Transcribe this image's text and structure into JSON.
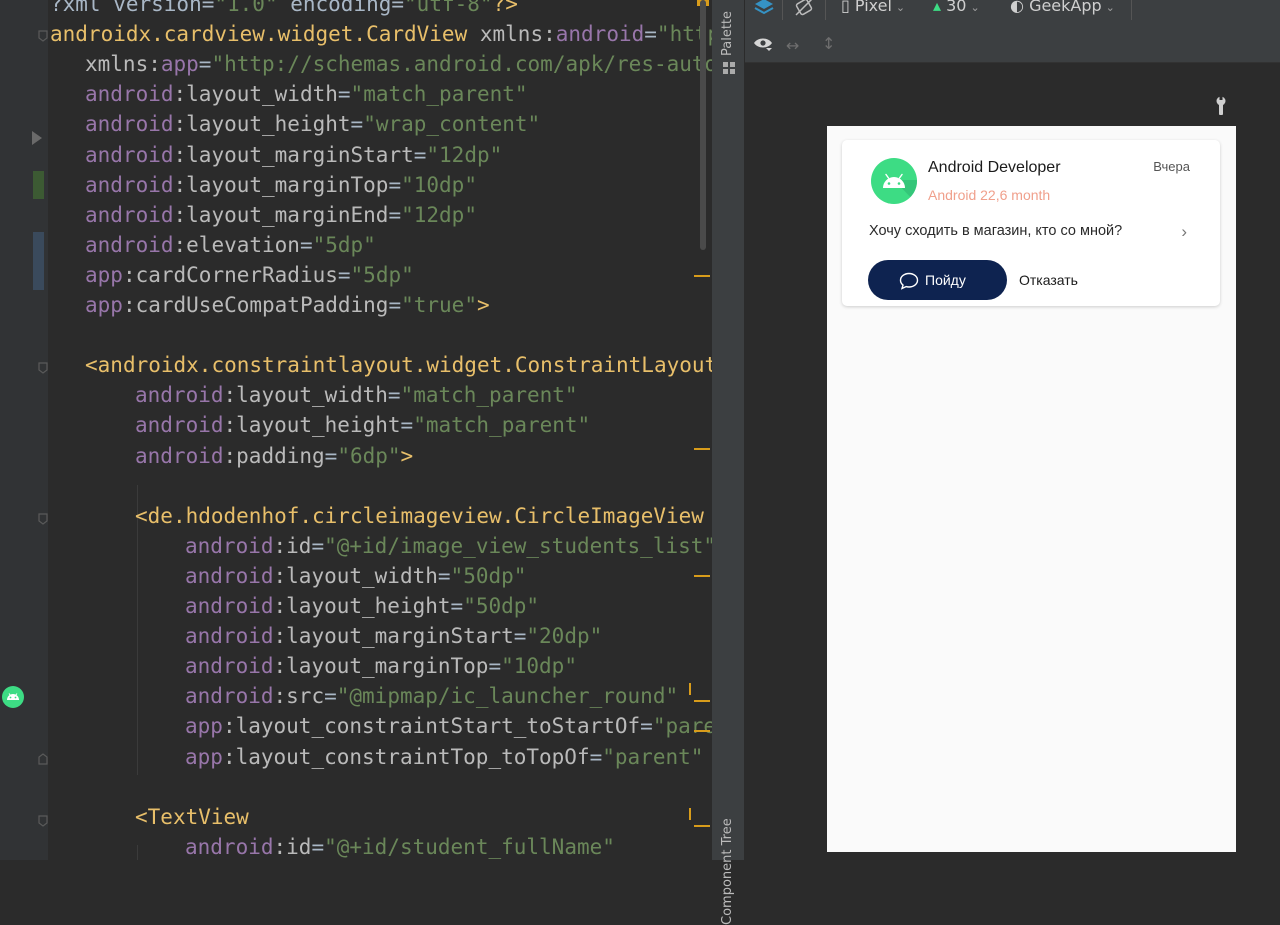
{
  "editor": {
    "lines": [
      [
        {
          "t": "?xml version=",
          "c": "tk-punc"
        },
        {
          "t": "\"1.0\"",
          "c": "tk-val"
        },
        {
          "t": " encoding=",
          "c": "tk-punc"
        },
        {
          "t": "\"utf-8\"",
          "c": "tk-val"
        },
        {
          "t": "?>",
          "c": "tk-br"
        }
      ],
      [
        {
          "t": "androidx.cardview.widget.CardView",
          "c": "tk-tag"
        },
        {
          "t": " xmlns:",
          "c": "tk-at"
        },
        {
          "t": "android",
          "c": "tk-ns"
        },
        {
          "t": "=",
          "c": "tk-punc"
        },
        {
          "t": "\"http",
          "c": "tk-val"
        }
      ],
      [
        {
          "t": "xmlns:",
          "c": "tk-at"
        },
        {
          "t": "app",
          "c": "tk-ns"
        },
        {
          "t": "=",
          "c": "tk-punc"
        },
        {
          "t": "\"http://schemas.android.com/apk/res-auto",
          "c": "tk-val"
        }
      ],
      [
        {
          "t": "android",
          "c": "tk-ns"
        },
        {
          "t": ":layout_width",
          "c": "tk-at"
        },
        {
          "t": "=",
          "c": "tk-punc"
        },
        {
          "t": "\"match_parent\"",
          "c": "tk-val"
        }
      ],
      [
        {
          "t": "android",
          "c": "tk-ns"
        },
        {
          "t": ":layout_height",
          "c": "tk-at"
        },
        {
          "t": "=",
          "c": "tk-punc"
        },
        {
          "t": "\"wrap_content\"",
          "c": "tk-val"
        }
      ],
      [
        {
          "t": "android",
          "c": "tk-ns"
        },
        {
          "t": ":layout_marginStart",
          "c": "tk-at"
        },
        {
          "t": "=",
          "c": "tk-punc"
        },
        {
          "t": "\"12dp\"",
          "c": "tk-val"
        }
      ],
      [
        {
          "t": "android",
          "c": "tk-ns"
        },
        {
          "t": ":layout_marginTop",
          "c": "tk-at"
        },
        {
          "t": "=",
          "c": "tk-punc"
        },
        {
          "t": "\"10dp\"",
          "c": "tk-val"
        }
      ],
      [
        {
          "t": "android",
          "c": "tk-ns"
        },
        {
          "t": ":layout_marginEnd",
          "c": "tk-at"
        },
        {
          "t": "=",
          "c": "tk-punc"
        },
        {
          "t": "\"12dp\"",
          "c": "tk-val"
        }
      ],
      [
        {
          "t": "android",
          "c": "tk-ns"
        },
        {
          "t": ":elevation",
          "c": "tk-at"
        },
        {
          "t": "=",
          "c": "tk-punc"
        },
        {
          "t": "\"5dp\"",
          "c": "tk-val"
        }
      ],
      [
        {
          "t": "app",
          "c": "tk-ns"
        },
        {
          "t": ":cardCornerRadius",
          "c": "tk-at"
        },
        {
          "t": "=",
          "c": "tk-punc"
        },
        {
          "t": "\"5dp\"",
          "c": "tk-val"
        }
      ],
      [
        {
          "t": "app",
          "c": "tk-ns"
        },
        {
          "t": ":cardUseCompatPadding",
          "c": "tk-at"
        },
        {
          "t": "=",
          "c": "tk-punc"
        },
        {
          "t": "\"true\"",
          "c": "tk-val"
        },
        {
          "t": ">",
          "c": "tk-br"
        }
      ],
      [],
      [
        {
          "t": "<",
          "c": "tk-br"
        },
        {
          "t": "androidx.constraintlayout.widget.ConstraintLayout",
          "c": "tk-tag"
        }
      ],
      [
        {
          "t": "android",
          "c": "tk-ns"
        },
        {
          "t": ":layout_width",
          "c": "tk-at"
        },
        {
          "t": "=",
          "c": "tk-punc"
        },
        {
          "t": "\"match_parent\"",
          "c": "tk-val"
        }
      ],
      [
        {
          "t": "android",
          "c": "tk-ns"
        },
        {
          "t": ":layout_height",
          "c": "tk-at"
        },
        {
          "t": "=",
          "c": "tk-punc"
        },
        {
          "t": "\"match_parent\"",
          "c": "tk-val"
        }
      ],
      [
        {
          "t": "android",
          "c": "tk-ns"
        },
        {
          "t": ":padding",
          "c": "tk-at"
        },
        {
          "t": "=",
          "c": "tk-punc"
        },
        {
          "t": "\"6dp\"",
          "c": "tk-val"
        },
        {
          "t": ">",
          "c": "tk-br"
        }
      ],
      [],
      [
        {
          "t": "<",
          "c": "tk-br"
        },
        {
          "t": "de.hdodenhof.circleimageview.CircleImageView",
          "c": "tk-tag"
        }
      ],
      [
        {
          "t": "android",
          "c": "tk-ns"
        },
        {
          "t": ":id",
          "c": "tk-at"
        },
        {
          "t": "=",
          "c": "tk-punc"
        },
        {
          "t": "\"@+id/image_view_students_list\"",
          "c": "tk-val"
        }
      ],
      [
        {
          "t": "android",
          "c": "tk-ns"
        },
        {
          "t": ":layout_width",
          "c": "tk-at"
        },
        {
          "t": "=",
          "c": "tk-punc"
        },
        {
          "t": "\"50dp\"",
          "c": "tk-val"
        }
      ],
      [
        {
          "t": "android",
          "c": "tk-ns"
        },
        {
          "t": ":layout_height",
          "c": "tk-at"
        },
        {
          "t": "=",
          "c": "tk-punc"
        },
        {
          "t": "\"50dp\"",
          "c": "tk-val"
        }
      ],
      [
        {
          "t": "android",
          "c": "tk-ns"
        },
        {
          "t": ":layout_marginStart",
          "c": "tk-at"
        },
        {
          "t": "=",
          "c": "tk-punc"
        },
        {
          "t": "\"20dp\"",
          "c": "tk-val"
        }
      ],
      [
        {
          "t": "android",
          "c": "tk-ns"
        },
        {
          "t": ":layout_marginTop",
          "c": "tk-at"
        },
        {
          "t": "=",
          "c": "tk-punc"
        },
        {
          "t": "\"10dp\"",
          "c": "tk-val"
        }
      ],
      [
        {
          "t": "android",
          "c": "tk-ns"
        },
        {
          "t": ":src",
          "c": "tk-at"
        },
        {
          "t": "=",
          "c": "tk-punc"
        },
        {
          "t": "\"@mipmap/ic_launcher_round\"",
          "c": "tk-val"
        }
      ],
      [
        {
          "t": "app",
          "c": "tk-ns"
        },
        {
          "t": ":layout_constraintStart_toStartOf",
          "c": "tk-at"
        },
        {
          "t": "=",
          "c": "tk-punc"
        },
        {
          "t": "\"pare",
          "c": "tk-val"
        }
      ],
      [
        {
          "t": "app",
          "c": "tk-ns"
        },
        {
          "t": ":layout_constraintTop_toTopOf",
          "c": "tk-at"
        },
        {
          "t": "=",
          "c": "tk-punc"
        },
        {
          "t": "\"parent\"",
          "c": "tk-val"
        }
      ],
      [],
      [
        {
          "t": "<",
          "c": "tk-br"
        },
        {
          "t": "TextView",
          "c": "tk-tag"
        }
      ],
      [
        {
          "t": "android",
          "c": "tk-ns"
        },
        {
          "t": ":id",
          "c": "tk-at"
        },
        {
          "t": "=",
          "c": "tk-punc"
        },
        {
          "t": "\"@+id/student_fullName\"",
          "c": "tk-val"
        }
      ]
    ]
  },
  "side_strip": {
    "palette": "Palette",
    "component_tree": "Component Tree"
  },
  "design_toolbar": {
    "device": "Pixel",
    "api": "30",
    "theme": "GeekApp"
  },
  "preview_card": {
    "name": "Android Developer",
    "subtitle": "Android 22,6 month",
    "date": "Вчера",
    "message": "Хочу сходить в магазин, кто со мной?",
    "accept_label": "Пойду",
    "decline_label": "Отказать",
    "accent_color": "#0e2350",
    "subtitle_color": "#f0a08c"
  }
}
